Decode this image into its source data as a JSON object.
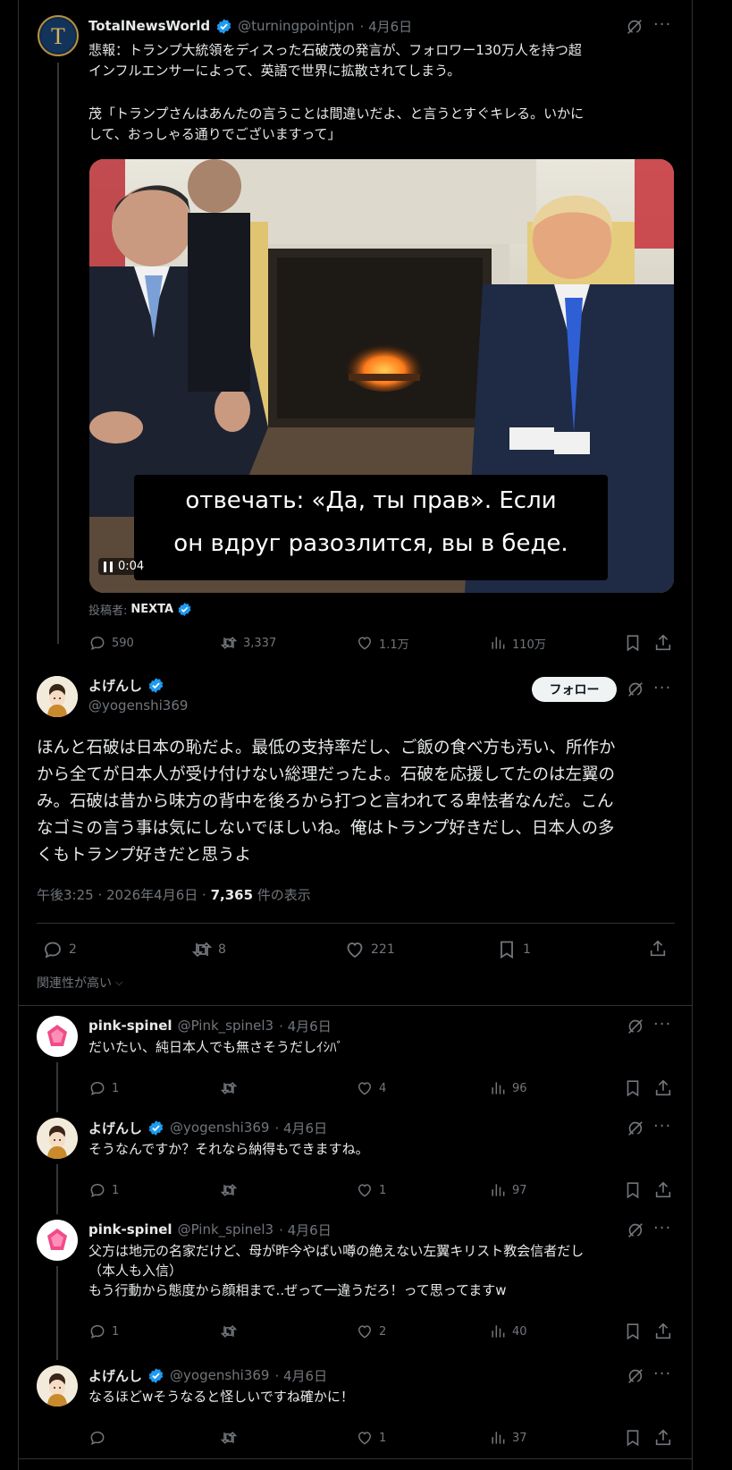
{
  "quoted_tweet": {
    "author_name": "TotalNewsWorld",
    "handle": "@turningpointjpn",
    "date": "· 4月6日",
    "text_line1": "悲報：トランプ大統領をディスった石破茂の発言が、フォロワー130万人を持つ超",
    "text_line2": "インフルエンサーによって、英語で世界に拡散されてしまう。",
    "text_line3": "茂「トランプさんはあんたの言うことは間違いだよ、と言うとすぐキレる。いかに",
    "text_line4": "して、おっしゃる通りでございますって」",
    "video": {
      "subtitle_line1": "отвечать: «Да, ты прав». Если",
      "subtitle_line2": "он вдруг разозлится, вы в беде.",
      "time": "0:04"
    },
    "posted_by_label": "投稿者:",
    "posted_by_name": "NEXTA",
    "stats": {
      "replies": "590",
      "reposts": "3,337",
      "likes": "1.1万",
      "views": "110万"
    }
  },
  "main_tweet": {
    "author_name": "よげんし",
    "handle": "@yogenshi369",
    "follow_label": "フォロー",
    "text": "ほんと石破は日本の恥だよ。最低の支持率だし、ご飯の食べ方も汚い、所作か\nから全てが日本人が受け付けない総理だったよ。石破を応援してたのは左翼の\nみ。石破は昔から味方の背中を後ろから打つと言われてる卑怯者なんだ。こん\nなゴミの言う事は気にしないでほしいね。俺はトランプ好きだし、日本人の多\nくもトランプ好きだと思うよ",
    "timestamp": "午後3:25 · 2026年4月6日 · ",
    "view_count": "7,365",
    "view_suffix": " 件の表示",
    "stats": {
      "replies": "2",
      "reposts": "8",
      "likes": "221",
      "bookmarks": "1"
    },
    "relevance_label": "関連性が高い"
  },
  "replies": [
    {
      "author_name": "pink-spinel",
      "handle": "@Pink_spinel3",
      "date": "· 4月6日",
      "text": "だいたい、純日本人でも無さそうだしｲｼﾊﾞ",
      "avatar": "pink",
      "stats": {
        "replies": "1",
        "reposts": "",
        "likes": "4",
        "views": "96"
      }
    },
    {
      "author_name": "よげんし",
      "handle": "@yogenshi369",
      "date": "· 4月6日",
      "text": "そうなんですか？それなら納得もできますね。",
      "avatar": "yogen",
      "stats": {
        "replies": "1",
        "reposts": "",
        "likes": "1",
        "views": "97"
      }
    },
    {
      "author_name": "pink-spinel",
      "handle": "@Pink_spinel3",
      "date": "· 4月6日",
      "text": "父方は地元の名家だけど、母が昨今やばい噂の絶えない左翼キリスト教会信者だし\n（本人も入信）\nもう行動から態度から顔相まで..ぜって一違うだろ！って思ってますw",
      "avatar": "pink",
      "stats": {
        "replies": "1",
        "reposts": "",
        "likes": "2",
        "views": "40"
      }
    },
    {
      "author_name": "よげんし",
      "handle": "@yogenshi369",
      "date": "· 4月6日",
      "text": "なるほどwそうなると怪しいですね確かに！",
      "avatar": "yogen",
      "stats": {
        "replies": "",
        "reposts": "",
        "likes": "1",
        "views": "37"
      }
    }
  ],
  "colors": {
    "background": "#000000",
    "text": "#e7e9ea",
    "muted": "#71767b",
    "verified": "#1d9bf0",
    "divider": "#2f3336"
  }
}
